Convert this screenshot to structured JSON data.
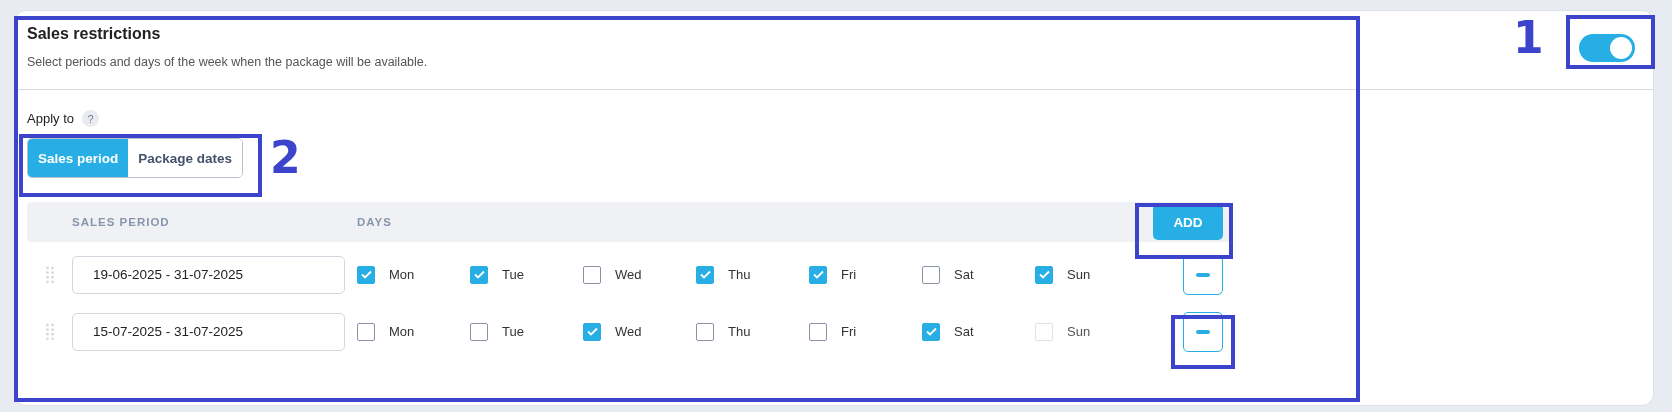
{
  "section": {
    "title": "Sales restrictions",
    "description": "Select periods and days of the week when the package will be available.",
    "enabled": true
  },
  "apply_to": {
    "label": "Apply to",
    "help": "?",
    "options": [
      {
        "label": "Sales period",
        "selected": true
      },
      {
        "label": "Package dates",
        "selected": false
      }
    ]
  },
  "table": {
    "columns": [
      "SALES PERIOD",
      "DAYS"
    ],
    "add_button": "ADD",
    "rows": [
      {
        "period": "19-06-2025 - 31-07-2025",
        "days": [
          {
            "label": "Mon",
            "checked": true,
            "disabled": false
          },
          {
            "label": "Tue",
            "checked": true,
            "disabled": false
          },
          {
            "label": "Wed",
            "checked": false,
            "disabled": false
          },
          {
            "label": "Thu",
            "checked": true,
            "disabled": false
          },
          {
            "label": "Fri",
            "checked": true,
            "disabled": false
          },
          {
            "label": "Sat",
            "checked": false,
            "disabled": false
          },
          {
            "label": "Sun",
            "checked": true,
            "disabled": false
          }
        ]
      },
      {
        "period": "15-07-2025 - 31-07-2025",
        "days": [
          {
            "label": "Mon",
            "checked": false,
            "disabled": false
          },
          {
            "label": "Tue",
            "checked": false,
            "disabled": false
          },
          {
            "label": "Wed",
            "checked": true,
            "disabled": false
          },
          {
            "label": "Thu",
            "checked": false,
            "disabled": false
          },
          {
            "label": "Fri",
            "checked": false,
            "disabled": false
          },
          {
            "label": "Sat",
            "checked": true,
            "disabled": false
          },
          {
            "label": "Sun",
            "checked": false,
            "disabled": true
          }
        ]
      }
    ]
  },
  "annotations": [
    {
      "label": "1"
    },
    {
      "label": "2"
    }
  ]
}
